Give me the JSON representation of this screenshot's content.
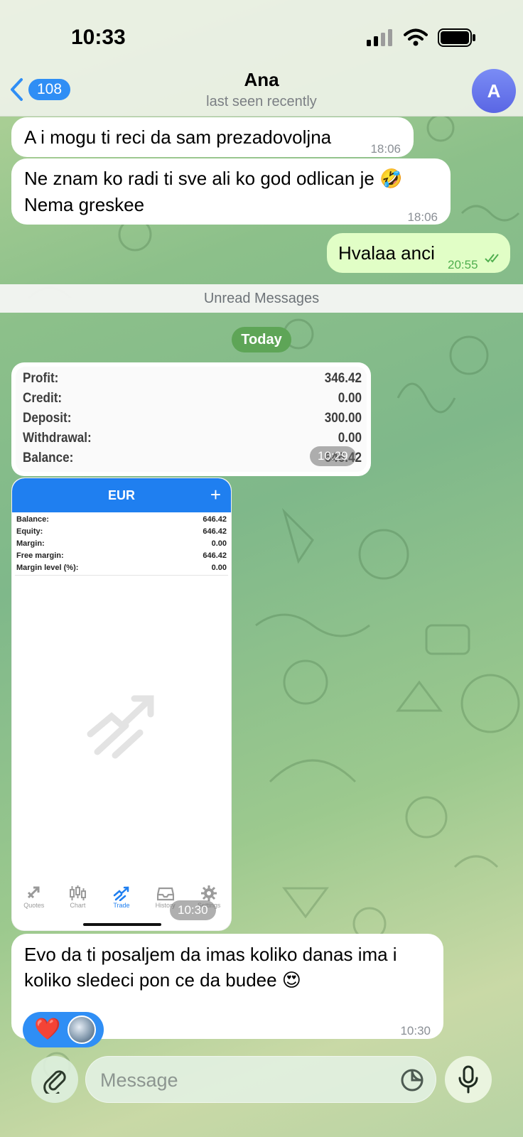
{
  "status_bar": {
    "time": "10:33"
  },
  "header": {
    "back_count": "108",
    "title": "Ana",
    "subtitle": "last seen recently",
    "avatar_letter": "A",
    "avatar_color": "#6c7aef"
  },
  "messages": [
    {
      "id": "m1",
      "direction": "incoming",
      "text": "A i mogu ti reci da sam prezadovoljna",
      "time": "18:06"
    },
    {
      "id": "m2",
      "direction": "incoming",
      "lines": [
        "Ne znam ko radi ti sve ali ko god odlican je 🤣",
        "Nema greskee"
      ],
      "time": "18:06"
    },
    {
      "id": "m3",
      "direction": "outgoing",
      "text": "Hvalaa anci",
      "time": "20:55",
      "status": "read"
    }
  ],
  "unread_label": "Unread Messages",
  "date_label": "Today",
  "photo_summary": {
    "rows": [
      {
        "label": "Profit:",
        "value": "346.42"
      },
      {
        "label": "Credit:",
        "value": "0.00"
      },
      {
        "label": "Deposit:",
        "value": "300.00"
      },
      {
        "label": "Withdrawal:",
        "value": "0.00"
      },
      {
        "label": "Balance:",
        "value": "646.42"
      }
    ],
    "time": "10:29"
  },
  "photo_trade": {
    "currency": "EUR",
    "plus": "+",
    "rows": [
      {
        "label": "Balance:",
        "value": "646.42"
      },
      {
        "label": "Equity:",
        "value": "646.42"
      },
      {
        "label": "Margin:",
        "value": "0.00"
      },
      {
        "label": "Free margin:",
        "value": "646.42"
      },
      {
        "label": "Margin level (%):",
        "value": "0.00"
      }
    ],
    "nav": [
      {
        "label": "Quotes",
        "icon": "quotes-icon",
        "active": false
      },
      {
        "label": "Chart",
        "icon": "candles-icon",
        "active": false
      },
      {
        "label": "Trade",
        "icon": "trade-icon",
        "active": true
      },
      {
        "label": "History",
        "icon": "inbox-icon",
        "active": false
      },
      {
        "label": "Settings",
        "icon": "gear-icon",
        "active": false
      }
    ],
    "time": "10:30"
  },
  "last_message": {
    "lines": [
      "Evo da ti posaljem da imas koliko danas ima i",
      "koliko sledeci pon ce da budee 😍"
    ],
    "reaction": "❤️",
    "time": "10:30"
  },
  "composer": {
    "placeholder": "Message"
  },
  "colors": {
    "accent": "#2f8ef5",
    "outgoing_bubble": "#e1fec6",
    "date_pill": "#5ea557",
    "trade_header": "#1f7ff0"
  }
}
